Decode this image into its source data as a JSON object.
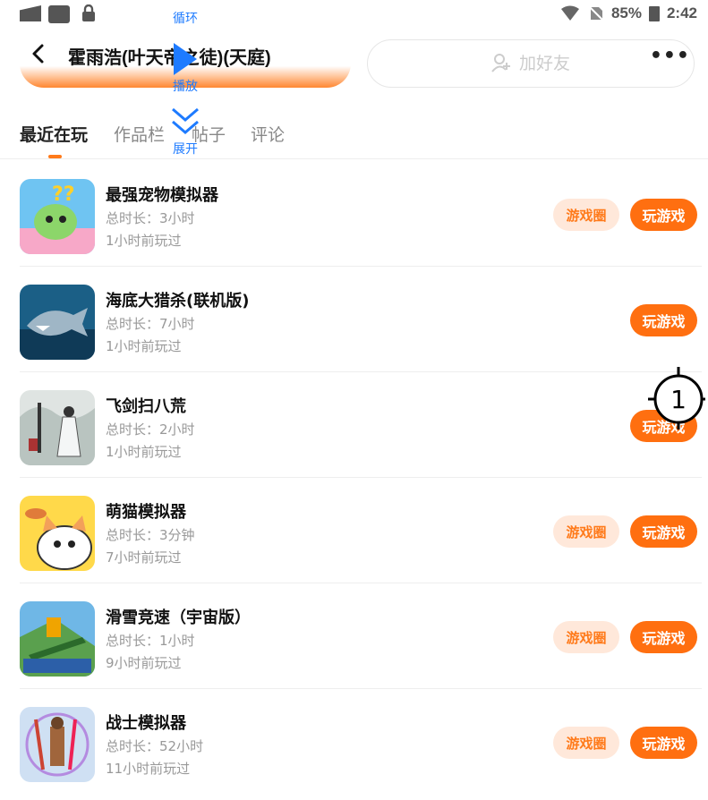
{
  "status": {
    "battery": "85%",
    "time": "2:42"
  },
  "header": {
    "title": "霍雨浩(叶天帝之徒)(天庭)",
    "add_friend": "加好友",
    "more": "•••"
  },
  "floating": {
    "loop": "循环",
    "play": "播放",
    "expand": "展开"
  },
  "tabs": [
    {
      "label": "最近在玩"
    },
    {
      "label": "作品栏"
    },
    {
      "label": "帖子"
    },
    {
      "label": "评论"
    }
  ],
  "games": [
    {
      "name": "最强宠物模拟器",
      "duration": "总时长：3小时",
      "last": "1小时前玩过",
      "circle": "游戏圈",
      "play": "玩游戏"
    },
    {
      "name": "海底大猎杀(联机版)",
      "duration": "总时长：7小时",
      "last": "1小时前玩过",
      "play": "玩游戏"
    },
    {
      "name": "飞剑扫八荒",
      "duration": "总时长：2小时",
      "last": "1小时前玩过",
      "play": "玩游戏"
    },
    {
      "name": "萌猫模拟器",
      "duration": "总时长：3分钟",
      "last": "7小时前玩过",
      "circle": "游戏圈",
      "play": "玩游戏"
    },
    {
      "name": "滑雪竞速（宇宙版）",
      "duration": "总时长：1小时",
      "last": "9小时前玩过",
      "circle": "游戏圈",
      "play": "玩游戏"
    },
    {
      "name": "战士模拟器",
      "duration": "总时长：52小时",
      "last": "11小时前玩过",
      "circle": "游戏圈",
      "play": "玩游戏"
    }
  ],
  "cursor": {
    "label": "1"
  },
  "colors": {
    "accent": "#ff6f10",
    "accent_light": "#ffe8da",
    "link_blue": "#1e7bff"
  }
}
